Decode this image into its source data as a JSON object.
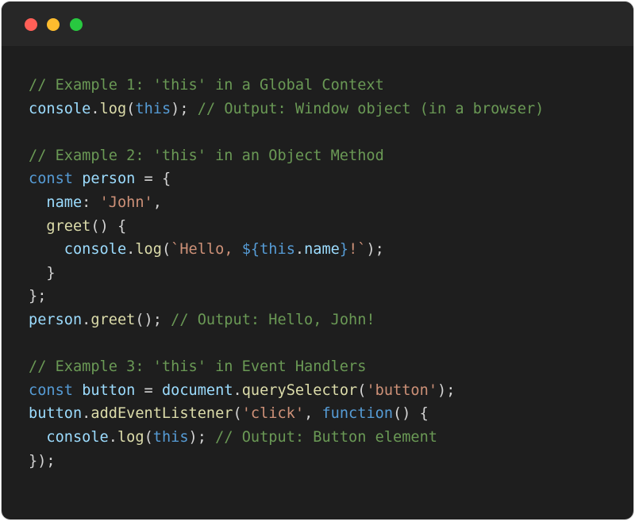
{
  "window": {
    "buttons": [
      {
        "name": "close",
        "color": "#ff5f57"
      },
      {
        "name": "minimize",
        "color": "#febc2e"
      },
      {
        "name": "maximize",
        "color": "#28c840"
      }
    ]
  },
  "theme": {
    "background": "#1e1e1e",
    "titlebar": "#272727",
    "comment": "#6a9955",
    "keyword": "#569cd6",
    "variable": "#9cdcfe",
    "function": "#dcdcaa",
    "string": "#ce9178",
    "punctuation": "#d4d4d4"
  },
  "code": {
    "language": "javascript",
    "lines": [
      [
        {
          "t": "comment",
          "v": "// Example 1: 'this' in a Global Context"
        }
      ],
      [
        {
          "t": "variable",
          "v": "console"
        },
        {
          "t": "punct",
          "v": "."
        },
        {
          "t": "function",
          "v": "log"
        },
        {
          "t": "punct",
          "v": "("
        },
        {
          "t": "keyword",
          "v": "this"
        },
        {
          "t": "punct",
          "v": "); "
        },
        {
          "t": "comment",
          "v": "// Output: Window object (in a browser)"
        }
      ],
      [],
      [
        {
          "t": "comment",
          "v": "// Example 2: 'this' in an Object Method"
        }
      ],
      [
        {
          "t": "keyword",
          "v": "const"
        },
        {
          "t": "plain",
          "v": " "
        },
        {
          "t": "variable",
          "v": "person"
        },
        {
          "t": "punct",
          "v": " = {"
        }
      ],
      [
        {
          "t": "plain",
          "v": "  "
        },
        {
          "t": "variable",
          "v": "name"
        },
        {
          "t": "punct",
          "v": ": "
        },
        {
          "t": "string",
          "v": "'John'"
        },
        {
          "t": "punct",
          "v": ","
        }
      ],
      [
        {
          "t": "plain",
          "v": "  "
        },
        {
          "t": "function",
          "v": "greet"
        },
        {
          "t": "punct",
          "v": "() {"
        }
      ],
      [
        {
          "t": "plain",
          "v": "    "
        },
        {
          "t": "variable",
          "v": "console"
        },
        {
          "t": "punct",
          "v": "."
        },
        {
          "t": "function",
          "v": "log"
        },
        {
          "t": "punct",
          "v": "("
        },
        {
          "t": "string",
          "v": "`Hello, "
        },
        {
          "t": "keyword",
          "v": "${"
        },
        {
          "t": "keyword",
          "v": "this"
        },
        {
          "t": "punct",
          "v": "."
        },
        {
          "t": "variable",
          "v": "name"
        },
        {
          "t": "keyword",
          "v": "}"
        },
        {
          "t": "string",
          "v": "!`"
        },
        {
          "t": "punct",
          "v": ");"
        }
      ],
      [
        {
          "t": "punct",
          "v": "  }"
        }
      ],
      [
        {
          "t": "punct",
          "v": "};"
        }
      ],
      [
        {
          "t": "variable",
          "v": "person"
        },
        {
          "t": "punct",
          "v": "."
        },
        {
          "t": "function",
          "v": "greet"
        },
        {
          "t": "punct",
          "v": "(); "
        },
        {
          "t": "comment",
          "v": "// Output: Hello, John!"
        }
      ],
      [],
      [
        {
          "t": "comment",
          "v": "// Example 3: 'this' in Event Handlers"
        }
      ],
      [
        {
          "t": "keyword",
          "v": "const"
        },
        {
          "t": "plain",
          "v": " "
        },
        {
          "t": "variable",
          "v": "button"
        },
        {
          "t": "punct",
          "v": " = "
        },
        {
          "t": "variable",
          "v": "document"
        },
        {
          "t": "punct",
          "v": "."
        },
        {
          "t": "function",
          "v": "querySelector"
        },
        {
          "t": "punct",
          "v": "("
        },
        {
          "t": "string",
          "v": "'button'"
        },
        {
          "t": "punct",
          "v": ");"
        }
      ],
      [
        {
          "t": "variable",
          "v": "button"
        },
        {
          "t": "punct",
          "v": "."
        },
        {
          "t": "function",
          "v": "addEventListener"
        },
        {
          "t": "punct",
          "v": "("
        },
        {
          "t": "string",
          "v": "'click'"
        },
        {
          "t": "punct",
          "v": ", "
        },
        {
          "t": "keyword",
          "v": "function"
        },
        {
          "t": "punct",
          "v": "() {"
        }
      ],
      [
        {
          "t": "plain",
          "v": "  "
        },
        {
          "t": "variable",
          "v": "console"
        },
        {
          "t": "punct",
          "v": "."
        },
        {
          "t": "function",
          "v": "log"
        },
        {
          "t": "punct",
          "v": "("
        },
        {
          "t": "keyword",
          "v": "this"
        },
        {
          "t": "punct",
          "v": "); "
        },
        {
          "t": "comment",
          "v": "// Output: Button element"
        }
      ],
      [
        {
          "t": "punct",
          "v": "});"
        }
      ]
    ]
  }
}
